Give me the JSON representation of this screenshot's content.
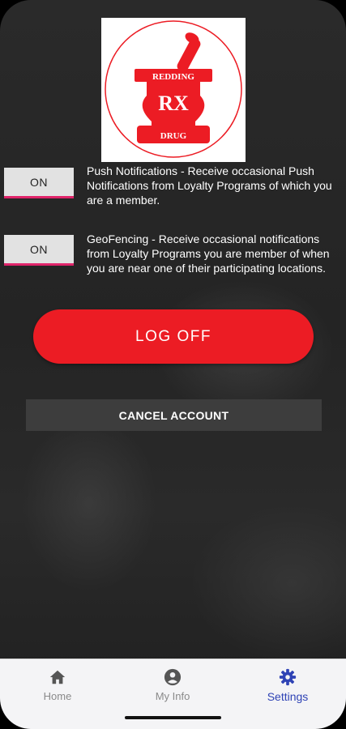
{
  "logo": {
    "top_text": "REDDING",
    "middle_text": "RX",
    "bottom_text": "DRUG",
    "brand_color": "#ec1c24"
  },
  "settings": {
    "push": {
      "toggle_label": "ON",
      "description": "Push Notifications - Receive occasional Push Notifications from Loyalty Programs of which you are a member."
    },
    "geofencing": {
      "toggle_label": "ON",
      "description": "GeoFencing - Receive occasional notifications from Loyalty Programs you are member of when you are near one of their participating locations."
    }
  },
  "actions": {
    "log_off_label": "LOG OFF",
    "cancel_account_label": "CANCEL ACCOUNT"
  },
  "tabbar": {
    "items": [
      {
        "label": "Home",
        "icon": "home-icon",
        "active": false
      },
      {
        "label": "My Info",
        "icon": "account-circle-icon",
        "active": false
      },
      {
        "label": "Settings",
        "icon": "gear-icon",
        "active": true
      }
    ],
    "active_color": "#2f43b5",
    "inactive_color": "#8a8a8a"
  }
}
